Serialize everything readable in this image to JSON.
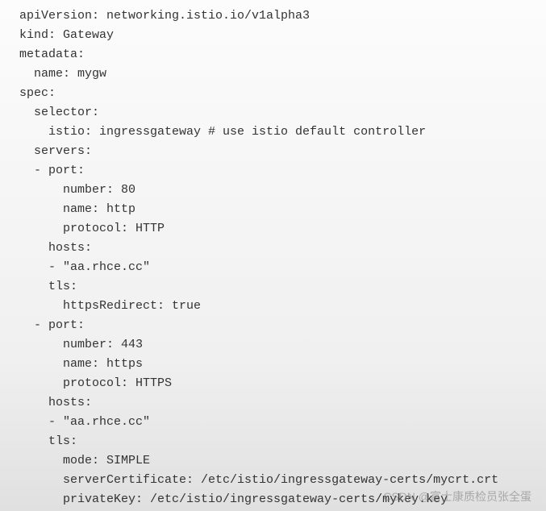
{
  "code": {
    "line1": "apiVersion: networking.istio.io/v1alpha3",
    "line2": "kind: Gateway",
    "line3": "metadata:",
    "line4": "  name: mygw",
    "line5": "spec:",
    "line6": "  selector:",
    "line7": "    istio: ingressgateway # use istio default controller",
    "line8": "  servers:",
    "line9": "  - port:",
    "line10": "      number: 80",
    "line11": "      name: http",
    "line12": "      protocol: HTTP",
    "line13": "    hosts:",
    "line14": "    - \"aa.rhce.cc\"",
    "line15": "    tls:",
    "line16": "      httpsRedirect: true",
    "line17": "  - port:",
    "line18": "      number: 443",
    "line19": "      name: https",
    "line20": "      protocol: HTTPS",
    "line21": "    hosts:",
    "line22": "    - \"aa.rhce.cc\"",
    "line23": "    tls:",
    "line24": "      mode: SIMPLE",
    "line25": "      serverCertificate: /etc/istio/ingressgateway-certs/mycrt.crt",
    "line26": "      privateKey: /etc/istio/ingressgateway-certs/mykey.key"
  },
  "watermark": "CSDN @富士康质检员张全蛋"
}
